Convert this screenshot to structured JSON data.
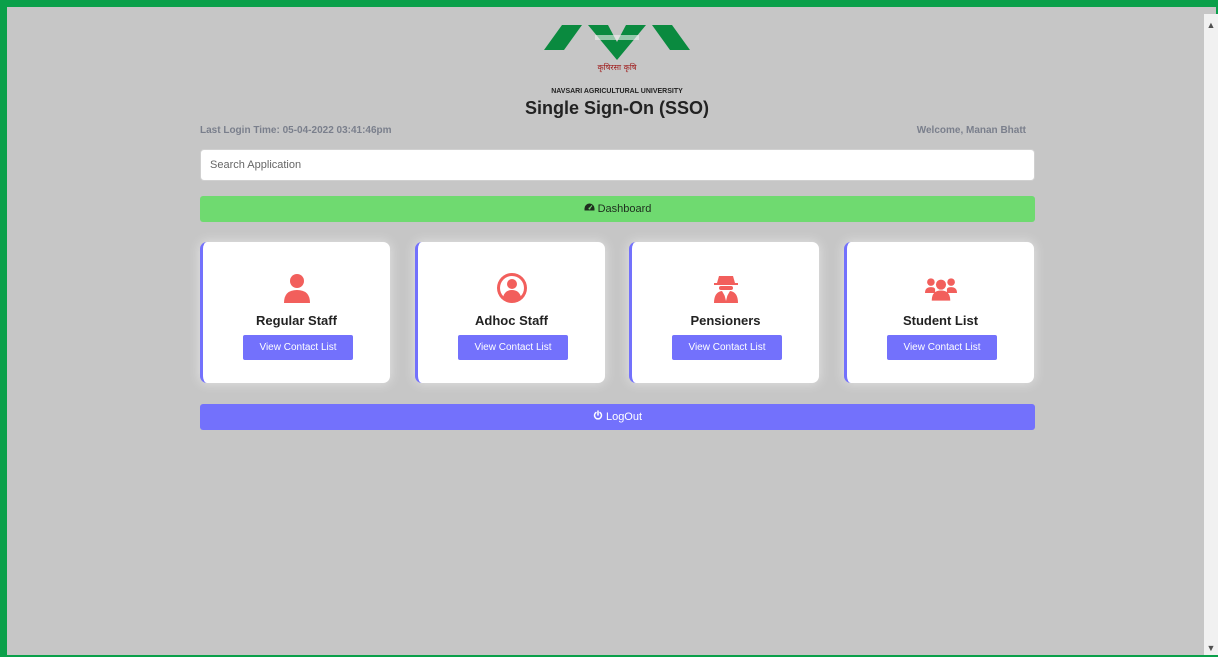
{
  "header": {
    "tagline": "कृषिरसा कृषि",
    "university": "NAVSARI AGRICULTURAL UNIVERSITY",
    "title": "Single Sign-On (SSO)"
  },
  "user": {
    "last_login": "Last Login Time: 05-04-2022 03:41:46pm",
    "welcome": "Welcome, Manan Bhatt"
  },
  "search": {
    "value": "",
    "placeholder": "Search Application"
  },
  "dashboard": {
    "label": "Dashboard",
    "icon": "tachometer-icon",
    "color": "#6fda70"
  },
  "cards": [
    {
      "title": "Regular Staff",
      "button": "View Contact List",
      "icon": "user-icon"
    },
    {
      "title": "Adhoc Staff",
      "button": "View Contact List",
      "icon": "user-circle-icon"
    },
    {
      "title": "Pensioners",
      "button": "View Contact List",
      "icon": "user-secret-icon"
    },
    {
      "title": "Student List",
      "button": "View Contact List",
      "icon": "users-icon"
    }
  ],
  "logout": {
    "label": "LogOut",
    "icon": "power-icon"
  },
  "colors": {
    "accent": "#7371fc",
    "icon": "#f25f5c",
    "brand_green": "#0aa04a",
    "background": "#c6c6c6"
  }
}
